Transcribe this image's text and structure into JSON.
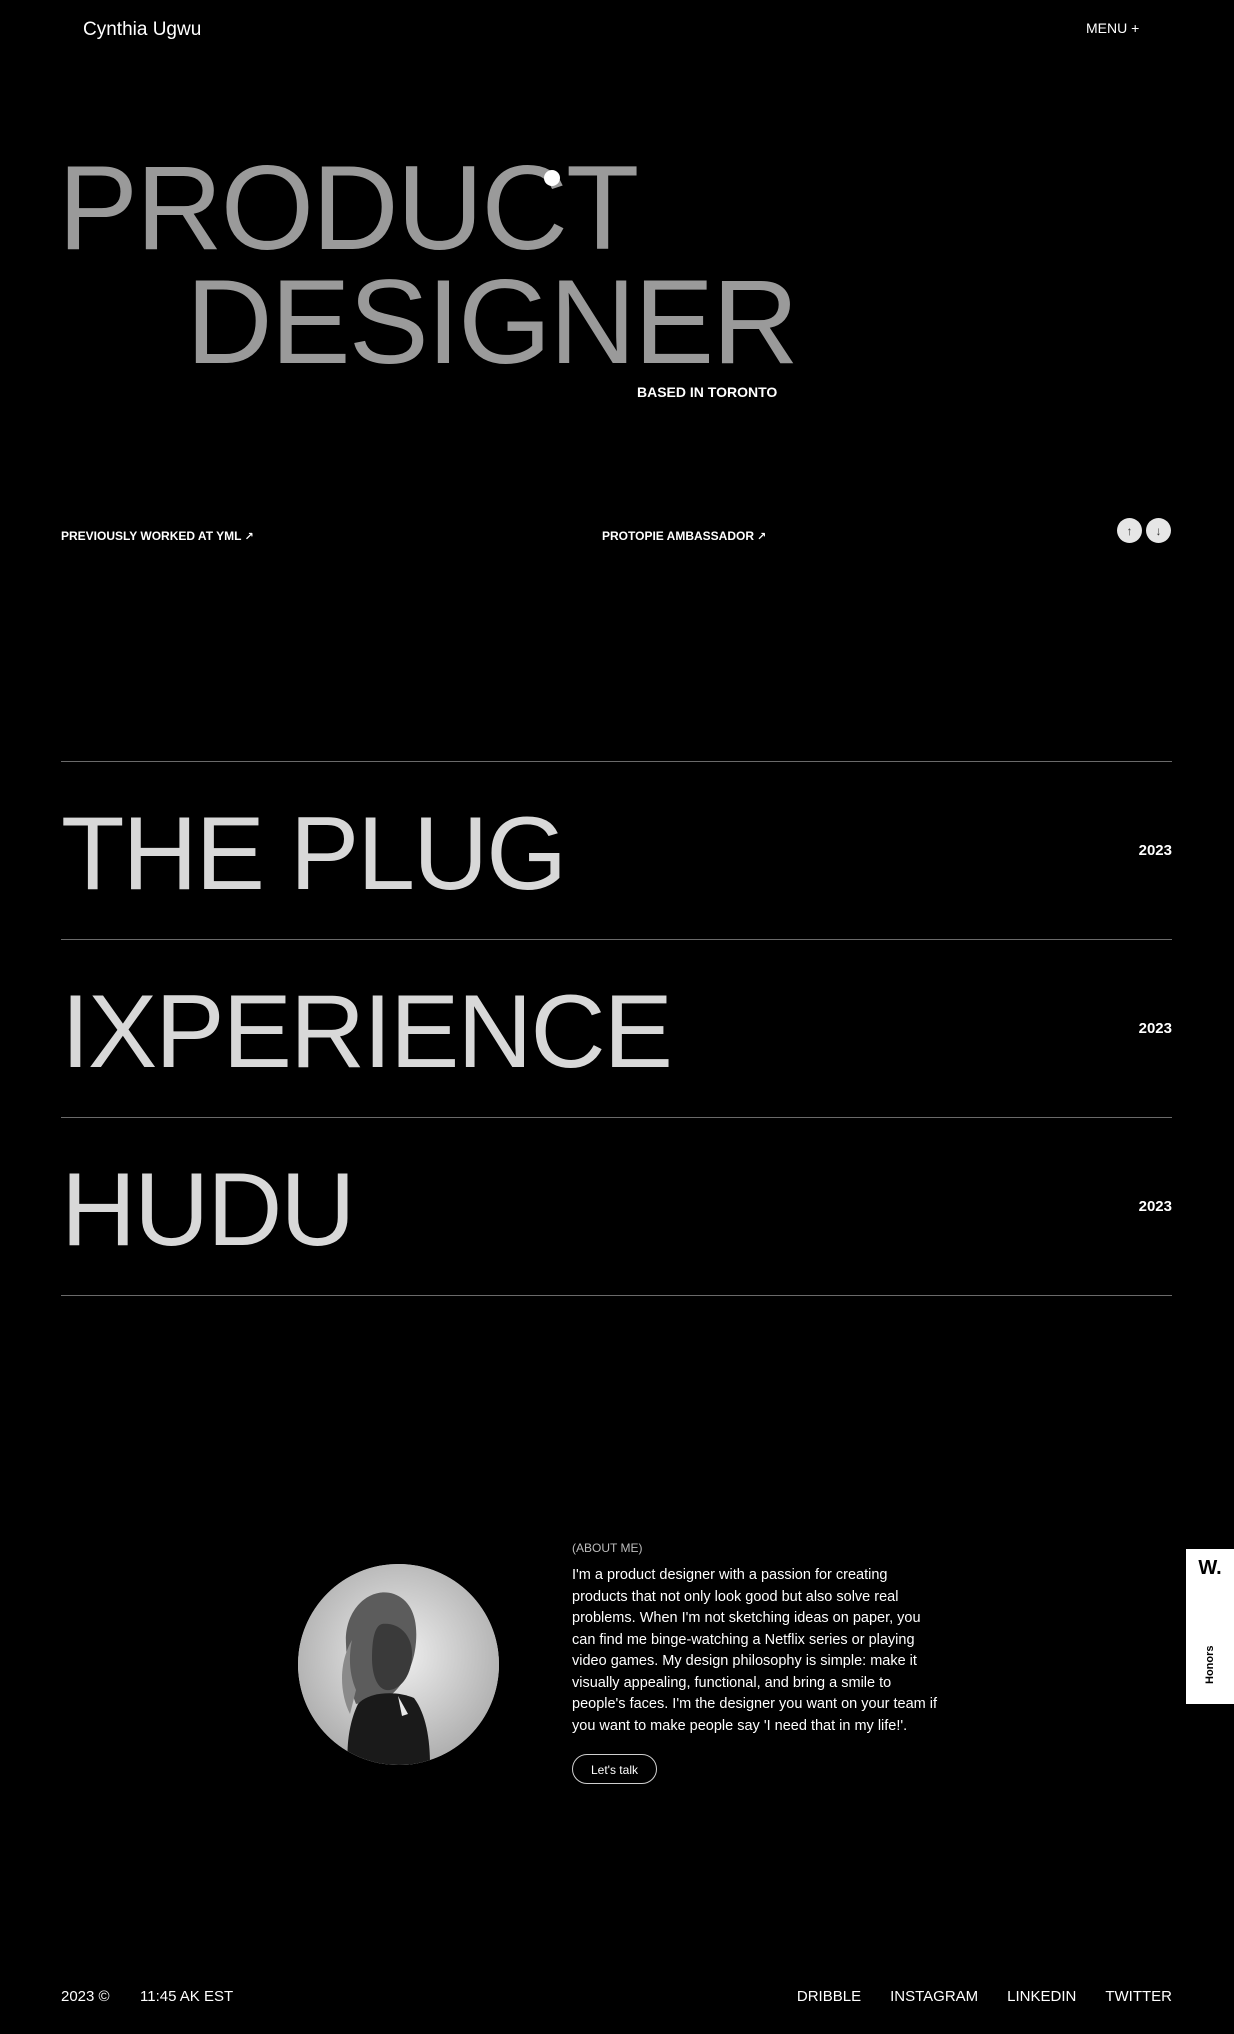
{
  "header": {
    "brand": "Cynthia Ugwu",
    "menu_label": "MENU +"
  },
  "hero": {
    "line1": "PRODUCT",
    "line2": "DESIGNER",
    "location": "BASED IN TORONTO"
  },
  "meta_links": [
    {
      "label": "PREVIOUSLY WORKED AT YML",
      "icon": "arrow-up-right-icon"
    },
    {
      "label": "PROTOPIE AMBASSADOR",
      "icon": "arrow-up-right-icon"
    }
  ],
  "scroll_controls": {
    "up_icon": "↑",
    "down_icon": "↓"
  },
  "projects": [
    {
      "name": "THE PLUG",
      "year": "2023"
    },
    {
      "name": "IXPERIENCE",
      "year": "2023"
    },
    {
      "name": "HUDU",
      "year": "2023"
    }
  ],
  "about": {
    "label": "(ABOUT ME)",
    "text": "I'm a product designer with a passion for creating products that not only look good but also solve real problems. When I'm not sketching ideas on paper, you can find me binge-watching a Netflix series or playing video games. My design philosophy is simple: make it visually appealing, functional, and bring a smile to people's faces. I'm the designer you want on your team if you want to make people say 'I need that in my life!'.",
    "cta": "Let's talk"
  },
  "badge": {
    "logo": "W.",
    "label": "Honors"
  },
  "footer": {
    "year": "2023 ©",
    "time": "11:45 AK EST",
    "links": [
      "DRIBBLE",
      "INSTAGRAM",
      "LINKEDIN",
      "TWITTER"
    ]
  }
}
